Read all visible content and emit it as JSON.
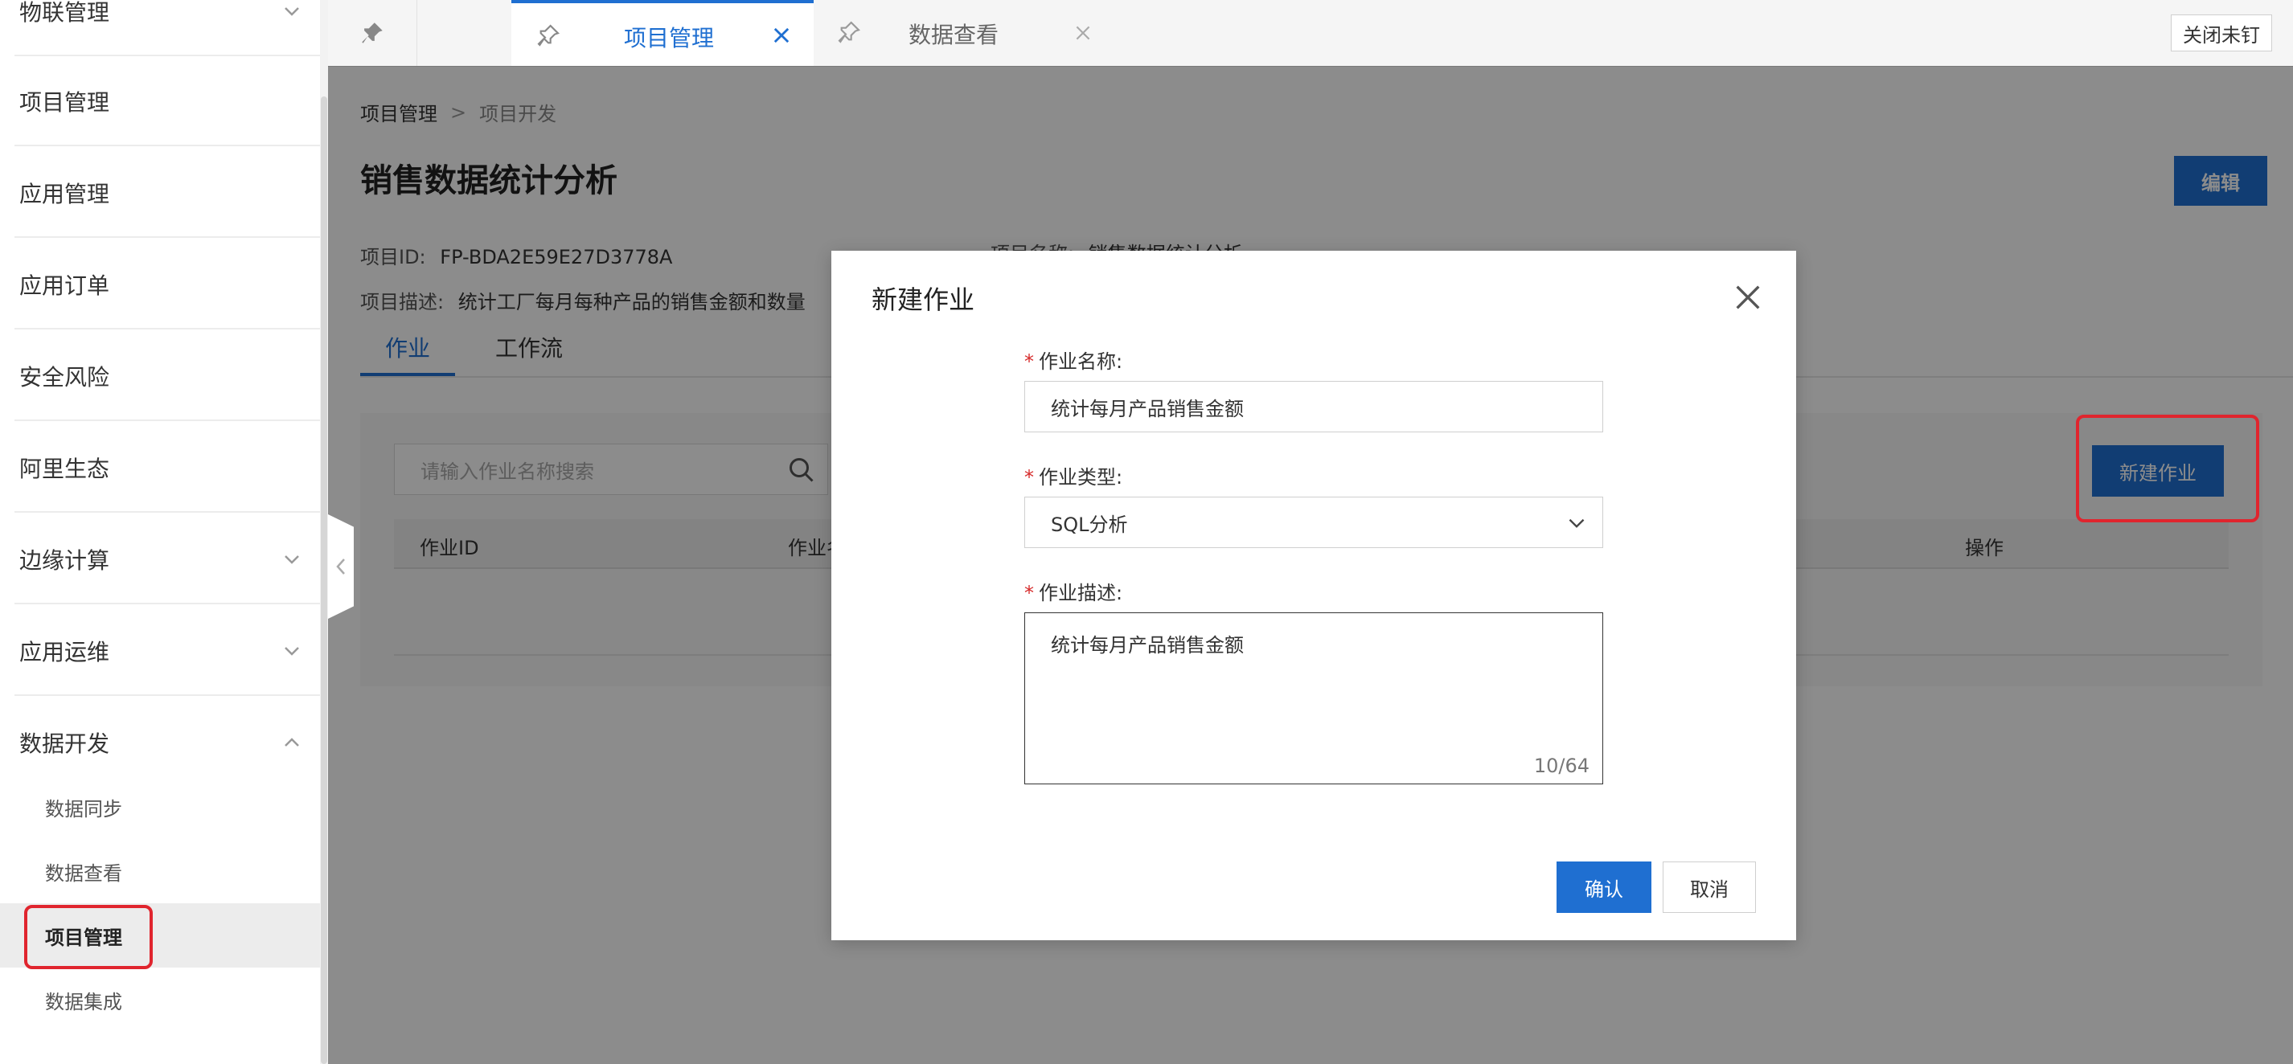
{
  "sidebar": {
    "items": [
      {
        "label": "物联管理",
        "chevron": "down"
      },
      {
        "label": "项目管理"
      },
      {
        "label": "应用管理"
      },
      {
        "label": "应用订单"
      },
      {
        "label": "安全风险"
      },
      {
        "label": "阿里生态"
      },
      {
        "label": "边缘计算",
        "chevron": "down"
      },
      {
        "label": "应用运维",
        "chevron": "down"
      },
      {
        "label": "数据开发",
        "chevron": "up"
      }
    ],
    "sub_items": [
      {
        "label": "数据同步"
      },
      {
        "label": "数据查看"
      },
      {
        "label": "项目管理",
        "active": true
      },
      {
        "label": "数据集成"
      }
    ]
  },
  "tabbar": {
    "tabs": [
      {
        "label": "项目管理",
        "active": true
      },
      {
        "label": "数据查看",
        "active": false
      }
    ],
    "close_unpinned_label": "关闭未钉"
  },
  "breadcrumb": [
    "项目管理",
    "项目开发"
  ],
  "breadcrumb_sep": ">",
  "page": {
    "title": "销售数据统计分析",
    "edit_label": "编辑",
    "project_id_label": "项目ID:",
    "project_id": "FP-BDA2E59E27D3778A",
    "project_name_label": "项目名称:",
    "project_name": "销售数据统计分析",
    "project_desc_label": "项目描述:",
    "project_desc": "统计工厂每月每种产品的销售金额和数量"
  },
  "content_tabs": [
    {
      "label": "作业",
      "active": true
    },
    {
      "label": "工作流",
      "active": false
    }
  ],
  "panel": {
    "search_placeholder": "请输入作业名称搜索",
    "new_job_label": "新建作业",
    "columns": [
      "作业ID",
      "作业名称",
      "操作"
    ]
  },
  "modal": {
    "title": "新建作业",
    "required_mark": "*",
    "fields": {
      "name_label": "作业名称:",
      "name_value": "统计每月产品销售金额",
      "type_label": "作业类型:",
      "type_value": "SQL分析",
      "desc_label": "作业描述:",
      "desc_value": "统计每月产品销售金额",
      "desc_count": "10/64"
    },
    "confirm_label": "确认",
    "cancel_label": "取消"
  },
  "colors": {
    "accent": "#1f6fd1",
    "highlight": "#e0252e",
    "required": "#d62a2a"
  }
}
